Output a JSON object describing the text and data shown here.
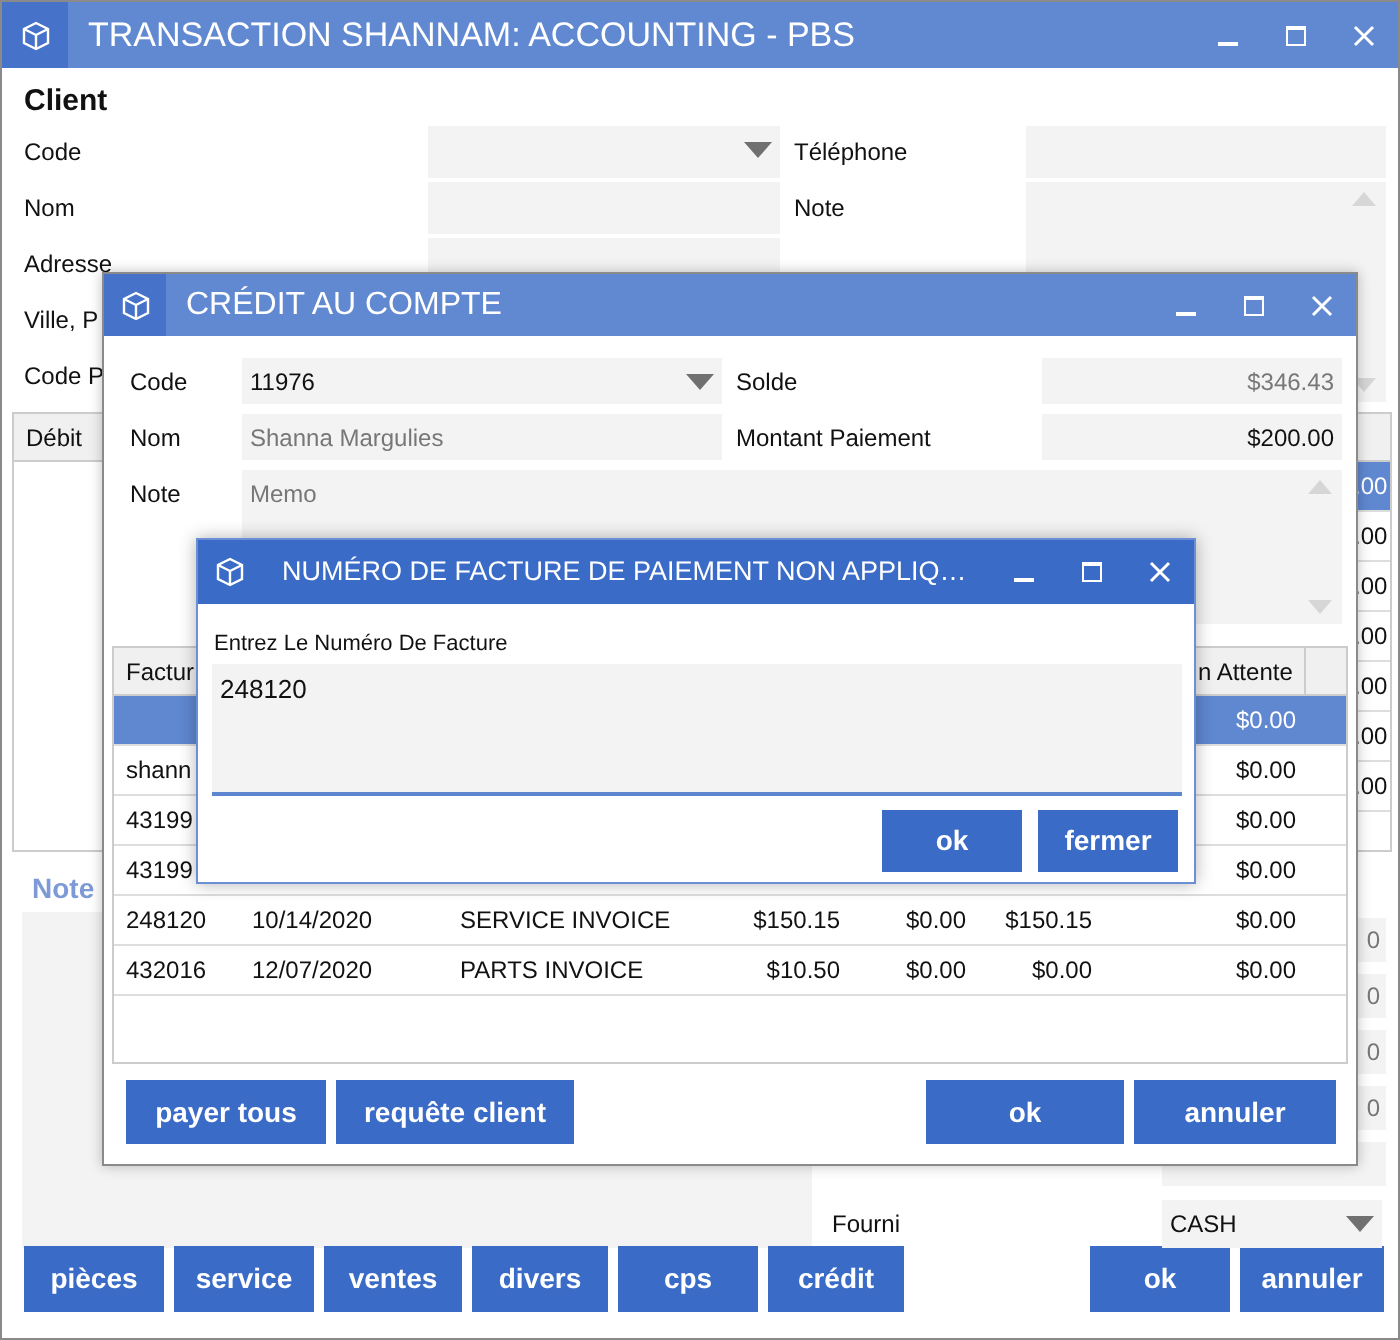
{
  "main_window": {
    "title": "TRANSACTION SHANNAM: ACCOUNTING - PBS",
    "section_title": "Client",
    "left_fields": [
      {
        "label": "Code",
        "kind": "dropdown"
      },
      {
        "label": "Nom",
        "kind": "text"
      },
      {
        "label": "Adresse",
        "kind": "text"
      },
      {
        "label": "Ville, P"
      },
      {
        "label": "Code P"
      }
    ],
    "right_fields": [
      {
        "label": "Téléphone",
        "kind": "text"
      },
      {
        "label": "Note",
        "kind": "textarea"
      }
    ],
    "grid": {
      "columns": [
        "Débit"
      ],
      "rows": [
        {
          "column_last": ".00",
          "selected": true
        },
        {
          "column_last": ".00",
          "selected": false
        },
        {
          "column_last": ".00",
          "selected": false
        },
        {
          "column_last": ".00",
          "selected": false
        },
        {
          "column_last": ".00",
          "selected": false
        },
        {
          "column_last": ".00",
          "selected": false
        },
        {
          "column_last": ".00",
          "selected": false
        }
      ]
    },
    "note_title": "Note",
    "payment_fields": [
      {
        "kind": "text",
        "value": "0"
      },
      {
        "kind": "text",
        "value": "0"
      },
      {
        "kind": "text",
        "value": "0"
      },
      {
        "kind": "text",
        "value": "0"
      },
      {
        "kind": "text"
      },
      {
        "kind": "dropdown",
        "label": "Fourni",
        "value": "CASH"
      }
    ],
    "buttons_left": [
      "pièces",
      "service",
      "ventes",
      "divers",
      "cps",
      "crédit"
    ],
    "buttons_right": [
      "ok",
      "annuler"
    ]
  },
  "credit_window": {
    "title": "CRÉDIT AU COMPTE",
    "left_fields": [
      {
        "label": "Code",
        "kind": "dropdown",
        "value": "11976",
        "muted": false
      },
      {
        "label": "Nom",
        "kind": "text",
        "value": "Shanna Margulies",
        "muted": true
      },
      {
        "label": "Note",
        "kind": "textarea",
        "placeholder": "Memo"
      }
    ],
    "right_fields": [
      {
        "label": "Solde",
        "value": "$346.43",
        "muted": true
      },
      {
        "label": "Montant Paiement",
        "value": "$200.00",
        "muted": false
      }
    ],
    "table": {
      "columns": [
        "Factur",
        "n Attente"
      ],
      "rows": [
        {
          "selected": true,
          "column_7": "$0.00"
        },
        {
          "selected": false,
          "column_1": "shann",
          "column_7": "$0.00"
        },
        {
          "selected": false,
          "column_1": "43199",
          "column_7": "$0.00"
        },
        {
          "selected": false,
          "column_1": "43199",
          "column_7": "$0.00"
        },
        {
          "selected": false,
          "column_1": "248120",
          "column_2": "10/14/2020",
          "column_3": "SERVICE INVOICE",
          "column_4": "$150.15",
          "column_5": "$0.00",
          "column_6": "$150.15",
          "column_7": "$0.00"
        },
        {
          "selected": false,
          "column_1": "432016",
          "column_2": "12/07/2020",
          "column_3": "PARTS INVOICE",
          "column_4": "$10.50",
          "column_5": "$0.00",
          "column_6": "$0.00",
          "column_7": "$0.00"
        }
      ]
    },
    "buttons_left": [
      "payer tous",
      "requête client"
    ],
    "buttons_right": [
      "ok",
      "annuler"
    ]
  },
  "invoice_dialog": {
    "title": "NUMÉRO DE FACTURE DE PAIEMENT NON APPLIQ…",
    "label": "Entrez Le Numéro De Facture",
    "value": "248120",
    "buttons": [
      "ok",
      "fermer"
    ]
  }
}
